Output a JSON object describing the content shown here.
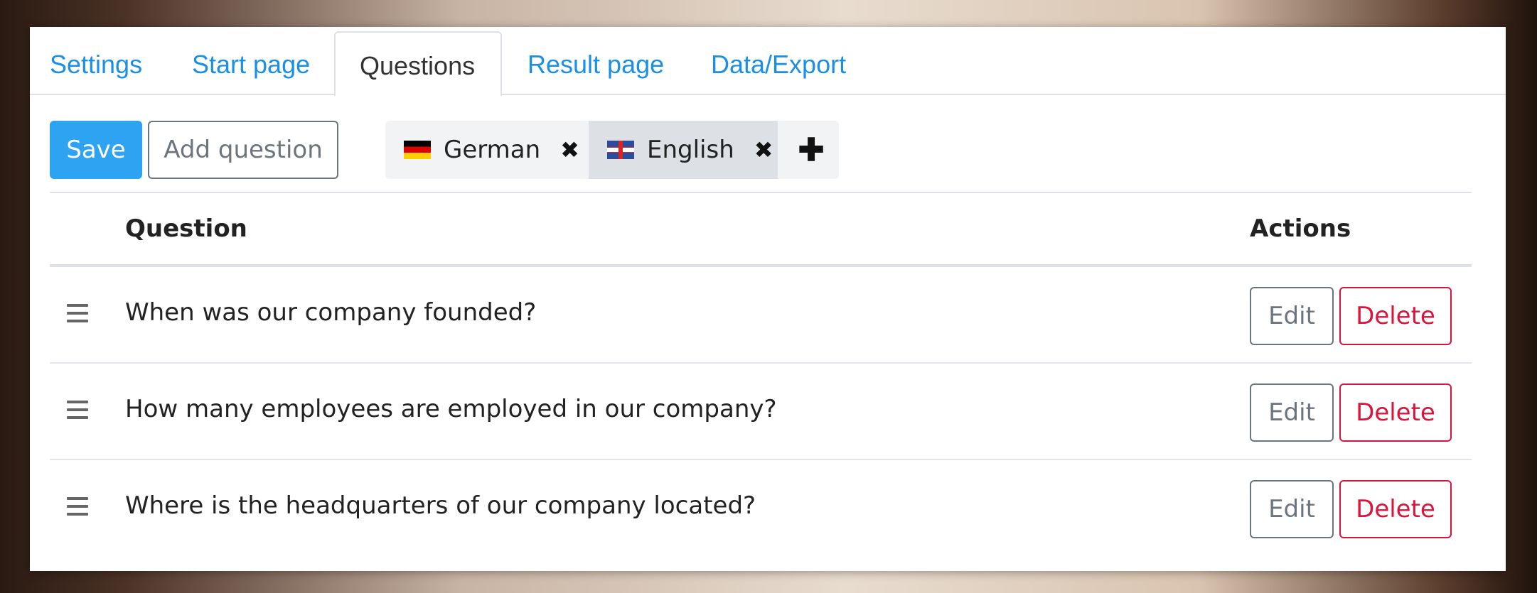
{
  "tabs": [
    {
      "label": "Settings"
    },
    {
      "label": "Start page"
    },
    {
      "label": "Questions"
    },
    {
      "label": "Result page"
    },
    {
      "label": "Data/Export"
    }
  ],
  "active_tab": "Questions",
  "toolbar": {
    "save_label": "Save",
    "add_question_label": "Add question",
    "languages": [
      {
        "label": "German",
        "flag": "de-flag-icon",
        "remove_icon": "close-icon"
      },
      {
        "label": "English",
        "flag": "uk-flag-icon",
        "remove_icon": "close-icon",
        "active": true
      }
    ],
    "add_language_icon": "plus-icon"
  },
  "table": {
    "columns": {
      "question": "Question",
      "actions": "Actions"
    },
    "rows": [
      {
        "question": "When was our company founded?",
        "edit": "Edit",
        "delete": "Delete"
      },
      {
        "question": "How many employees are employed in our company?",
        "edit": "Edit",
        "delete": "Delete"
      },
      {
        "question": "Where is the headquarters of our company located?",
        "edit": "Edit",
        "delete": "Delete"
      }
    ]
  },
  "colors": {
    "link": "#1a8fe3",
    "primary": "#2ea3f2",
    "danger": "#dc143c",
    "secondary": "#6c757d"
  }
}
